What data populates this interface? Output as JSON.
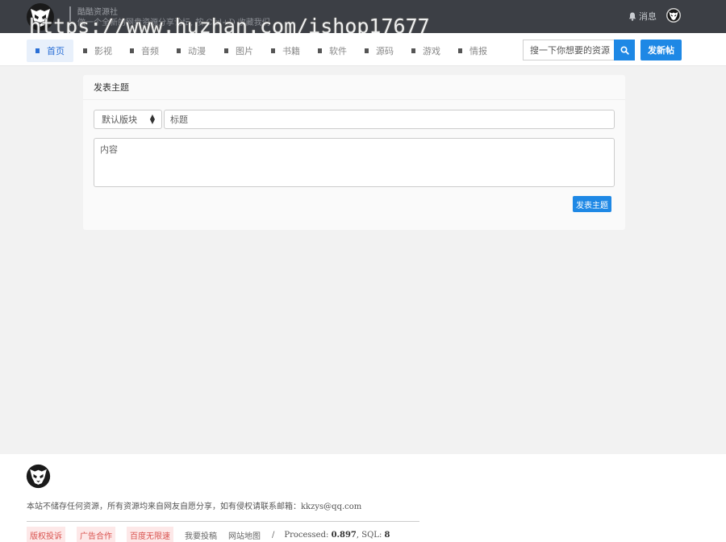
{
  "header": {
    "brand_name": "酷酷资源社",
    "slogan": "做一个全新的网盘资源分享论坛, 按 Ctrl+D 收藏我们",
    "messages_label": "消息",
    "watermark": "https://www.huzhan.com/ishop17677"
  },
  "nav": {
    "items": [
      {
        "label": "首页",
        "active": true
      },
      {
        "label": "影视"
      },
      {
        "label": "音频"
      },
      {
        "label": "动漫"
      },
      {
        "label": "图片"
      },
      {
        "label": "书籍"
      },
      {
        "label": "软件"
      },
      {
        "label": "源码"
      },
      {
        "label": "游戏"
      },
      {
        "label": "情报"
      }
    ],
    "search_placeholder": "搜一下你想要的资源",
    "post_button": "发新帖"
  },
  "form": {
    "title": "发表主题",
    "forum_select": "默认版块",
    "title_placeholder": "标题",
    "content_placeholder": "内容",
    "submit": "发表主题"
  },
  "footer": {
    "notice": "本站不储存任何资源，所有资源均来自网友自愿分享，如有侵权请联系邮箱：kkzys@qq.com",
    "links": {
      "copyright": "版权投诉",
      "ads": "广告合作",
      "baidu": "百度无限速",
      "contribute": "我要投稿",
      "sitemap": "网站地图",
      "slash": "/"
    },
    "processed_label": "Processed:",
    "processed_value": "0.897",
    "sql_label": ", SQL:",
    "sql_value": "8"
  },
  "colors": {
    "topbar": "#3c3f45",
    "accent": "#1e88e5",
    "tag_bg": "#fde8e8",
    "tag_text": "#d9534f"
  }
}
